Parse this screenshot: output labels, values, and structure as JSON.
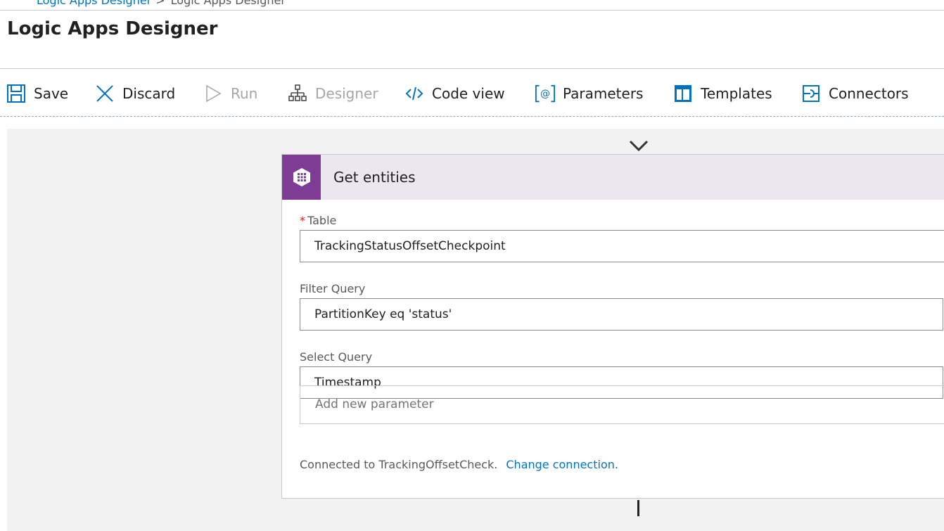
{
  "breadcrumb": {
    "link_label": "Logic Apps Designer",
    "separator": ">",
    "current_label": "Logic Apps Designer"
  },
  "page_title": "Logic Apps Designer",
  "toolbar": {
    "save_label": "Save",
    "discard_label": "Discard",
    "run_label": "Run",
    "designer_label": "Designer",
    "code_view_label": "Code view",
    "parameters_label": "Parameters",
    "templates_label": "Templates",
    "connectors_label": "Connectors",
    "disabled_items": [
      "Run",
      "Designer"
    ]
  },
  "action_card": {
    "title": "Get entities",
    "icon": "azure-table-storage-icon",
    "fields": [
      {
        "label": "Table",
        "required": true,
        "value": "TrackingStatusOffsetCheckpoint"
      },
      {
        "label": "Filter Query",
        "required": false,
        "value": "PartitionKey eq 'status'"
      },
      {
        "label": "Select Query",
        "required": false,
        "value": "Timestamp"
      }
    ],
    "add_parameter_placeholder": "Add new parameter",
    "connection_text": "Connected to TrackingOffsetCheck.",
    "change_connection_label": "Change connection."
  },
  "colors": {
    "accent": "#0072c6",
    "card_header_bg": "#ece6f1",
    "card_icon_bg": "#7e3c94",
    "required_marker": "#e81123",
    "canvas_bg": "#f2f2f2"
  }
}
